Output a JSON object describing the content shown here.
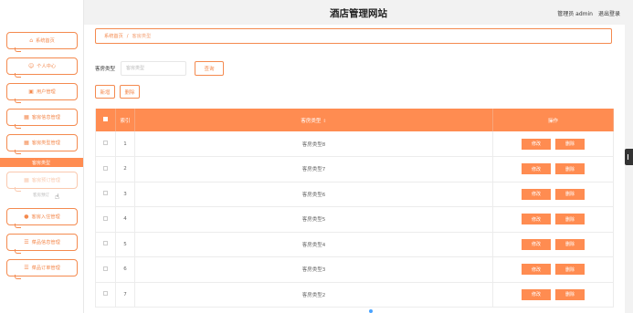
{
  "header": {
    "title": "酒店管理网站",
    "role_user": "管理员 admin",
    "logout": "退出登录"
  },
  "sidebar": {
    "items": [
      {
        "icon": "home-icon",
        "glyph": "⌂",
        "label": "系统首页"
      },
      {
        "icon": "person-icon",
        "glyph": "☺",
        "label": "个人中心"
      },
      {
        "icon": "users-icon",
        "glyph": "▣",
        "label": "用户管理"
      },
      {
        "icon": "grid-icon",
        "glyph": "▦",
        "label": "客房信息管理"
      },
      {
        "icon": "grid-icon",
        "glyph": "▦",
        "label": "客房类型管理"
      },
      {
        "icon": "grid-icon",
        "glyph": "▦",
        "label": "客房预订管理"
      },
      {
        "icon": "pin-icon",
        "glyph": "●",
        "label": "客房入住管理"
      },
      {
        "icon": "list-icon",
        "glyph": "☰",
        "label": "菜品信息管理"
      },
      {
        "icon": "list-icon",
        "glyph": "☰",
        "label": "菜品订单管理"
      }
    ],
    "active_sub": "客房类型",
    "faded_sub": "客房预订"
  },
  "breadcrumb": {
    "home": "系统首页",
    "sep": "/",
    "current": "客房类型"
  },
  "search": {
    "label": "客房类型",
    "placeholder": "客房类型",
    "button": "查询"
  },
  "actions": {
    "add": "新增",
    "delete": "删除"
  },
  "table": {
    "columns": {
      "index": "索引",
      "type": "客房类型",
      "ops": "操作"
    },
    "rows": [
      {
        "index": "1",
        "type": "客房类型8"
      },
      {
        "index": "2",
        "type": "客房类型7"
      },
      {
        "index": "3",
        "type": "客房类型6"
      },
      {
        "index": "4",
        "type": "客房类型5"
      },
      {
        "index": "5",
        "type": "客房类型4"
      },
      {
        "index": "6",
        "type": "客房类型3"
      },
      {
        "index": "7",
        "type": "客房类型2"
      }
    ],
    "edit_label": "修改",
    "delete_label": "删除"
  },
  "colors": {
    "accent": "#ff8c51",
    "border": "#f48a4f"
  }
}
